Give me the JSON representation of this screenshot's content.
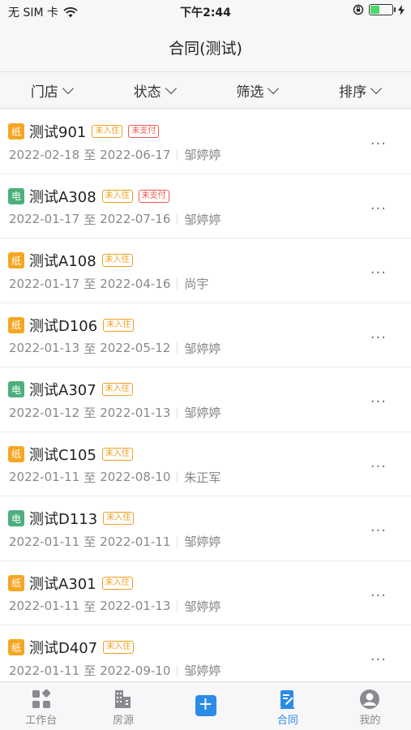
{
  "status": {
    "carrier": "无 SIM 卡",
    "time": "下午2:44"
  },
  "nav": {
    "title": "合同(测试)"
  },
  "filters": [
    {
      "label": "门店"
    },
    {
      "label": "状态"
    },
    {
      "label": "筛选"
    },
    {
      "label": "排序"
    }
  ],
  "contracts": [
    {
      "type": "纸",
      "name": "测试901",
      "tags": [
        "未入住",
        "未支付"
      ],
      "start": "2022-02-18",
      "end": "2022-06-17",
      "tenant": "邹婷婷"
    },
    {
      "type": "电",
      "name": "测试A308",
      "tags": [
        "未入住",
        "未支付"
      ],
      "start": "2022-01-17",
      "end": "2022-07-16",
      "tenant": "邹婷婷"
    },
    {
      "type": "纸",
      "name": "测试A108",
      "tags": [
        "未入住"
      ],
      "start": "2022-01-17",
      "end": "2022-04-16",
      "tenant": "尚宇"
    },
    {
      "type": "纸",
      "name": "测试D106",
      "tags": [
        "未入住"
      ],
      "start": "2022-01-13",
      "end": "2022-05-12",
      "tenant": "邹婷婷"
    },
    {
      "type": "电",
      "name": "测试A307",
      "tags": [
        "未入住"
      ],
      "start": "2022-01-12",
      "end": "2022-01-13",
      "tenant": "邹婷婷"
    },
    {
      "type": "纸",
      "name": "测试C105",
      "tags": [
        "未入住"
      ],
      "start": "2022-01-11",
      "end": "2022-08-10",
      "tenant": "朱正军"
    },
    {
      "type": "电",
      "name": "测试D113",
      "tags": [
        "未入住"
      ],
      "start": "2022-01-11",
      "end": "2022-01-11",
      "tenant": "邹婷婷"
    },
    {
      "type": "纸",
      "name": "测试A301",
      "tags": [
        "未入住"
      ],
      "start": "2022-01-11",
      "end": "2022-01-13",
      "tenant": "邹婷婷"
    },
    {
      "type": "纸",
      "name": "测试D407",
      "tags": [
        "未入住"
      ],
      "start": "2022-01-11",
      "end": "2022-09-10",
      "tenant": "邹婷婷"
    }
  ],
  "date_separator": "至",
  "more_label": "···",
  "tabbar": [
    {
      "label": "工作台",
      "icon": "grid-icon",
      "active": false
    },
    {
      "label": "房源",
      "icon": "building-icon",
      "active": false
    },
    {
      "label": "",
      "icon": "plus-icon",
      "active": false
    },
    {
      "label": "合同",
      "icon": "contract-icon",
      "active": true
    },
    {
      "label": "我的",
      "icon": "profile-icon",
      "active": false
    }
  ],
  "colors": {
    "accent": "#2b8ce6",
    "paper_badge": "#f5a623",
    "electronic_badge": "#4caf7d",
    "tag_orange": "#f0a020",
    "tag_red": "#ef5a52"
  }
}
